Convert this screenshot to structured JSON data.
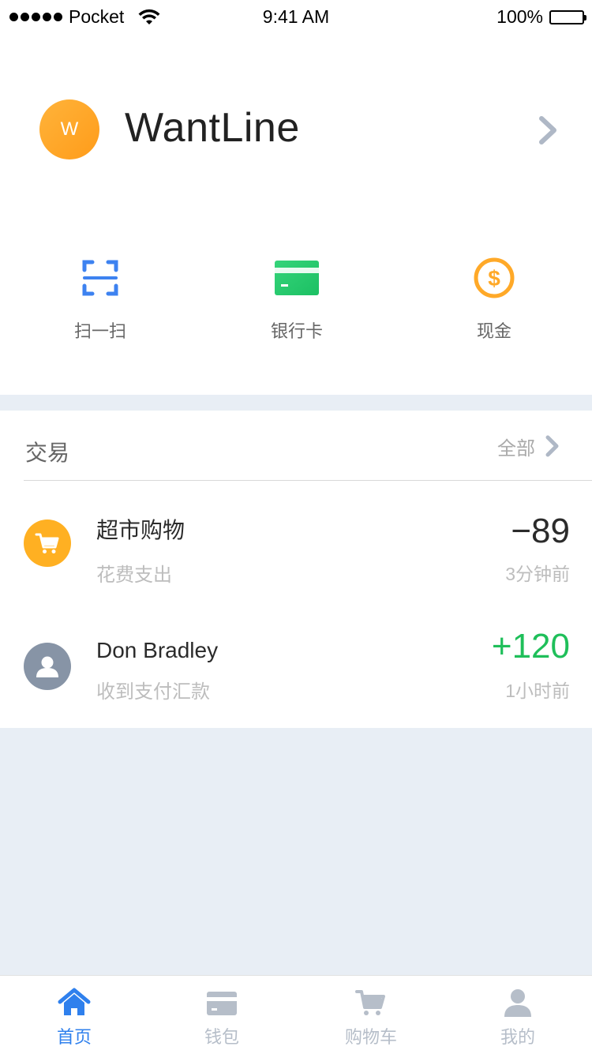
{
  "status_bar": {
    "carrier": "Pocket",
    "time": "9:41 AM",
    "battery": "100%"
  },
  "profile": {
    "avatar_letter": "W",
    "name": "WantLine"
  },
  "quick_actions": [
    {
      "label": "扫一扫",
      "icon": "scan-icon",
      "color": "#3D82F0"
    },
    {
      "label": "银行卡",
      "icon": "bank-card-icon",
      "color": "#25C965"
    },
    {
      "label": "现金",
      "icon": "cash-dollar-icon",
      "color": "#FFA928"
    }
  ],
  "transactions": {
    "title": "交易",
    "all_label": "全部",
    "items": [
      {
        "title": "超市购物",
        "subtitle": "花费支出",
        "amount": "−89",
        "time": "3分钟前",
        "amount_color": "#2B2B2B",
        "icon": "shopping-cart-icon",
        "icon_bg": "#FFB022"
      },
      {
        "title": "Don Bradley",
        "subtitle": "收到支付汇款",
        "amount": "+120",
        "time": "1小时前",
        "amount_color": "#1FBF5A",
        "icon": "user-icon",
        "icon_bg": "#8794A6"
      }
    ]
  },
  "tabbar": {
    "items": [
      {
        "label": "首页",
        "icon": "home-icon",
        "active": true
      },
      {
        "label": "钱包",
        "icon": "wallet-card-icon",
        "active": false
      },
      {
        "label": "购物车",
        "icon": "cart-icon",
        "active": false
      },
      {
        "label": "我的",
        "icon": "profile-icon",
        "active": false
      }
    ]
  },
  "colors": {
    "accent": "#2F80ED",
    "inactive": "#B6BEC9",
    "background": "#E8EEF5"
  }
}
